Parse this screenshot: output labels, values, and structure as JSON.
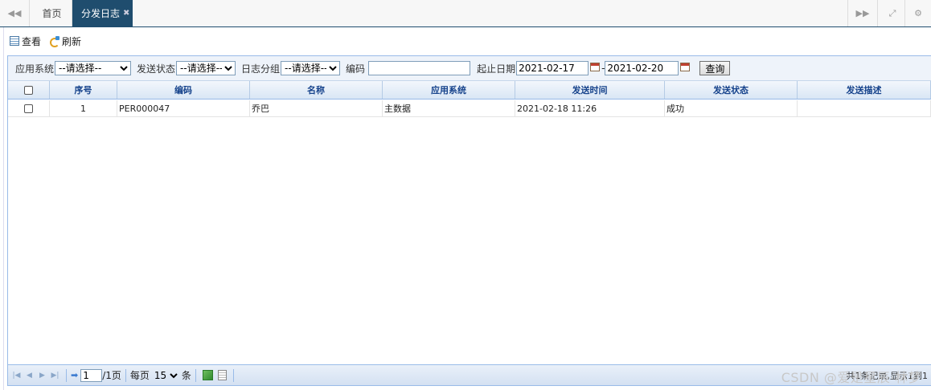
{
  "tabs": {
    "home": "首页",
    "active": "分发日志",
    "close": "✖"
  },
  "nav_icons": [
    "double-chevron-left-icon",
    "double-chevron-right-icon",
    "fullscreen-icon",
    "gear-icon"
  ],
  "toolbar": {
    "view": "查看",
    "refresh": "刷新"
  },
  "filter": {
    "app_label": "应用系统",
    "app_value": "--请选择--",
    "status_label": "发送状态",
    "status_value": "--请选择--",
    "group_label": "日志分组",
    "group_value": "--请选择--",
    "code_label": "编码",
    "code_value": "",
    "date_label": "起止日期",
    "date_start": "2021-02-17",
    "date_sep": "-",
    "date_end": "2021-02-20",
    "query": "查询"
  },
  "columns": [
    "序号",
    "编码",
    "名称",
    "应用系统",
    "发送时间",
    "发送状态",
    "发送描述"
  ],
  "rows": [
    {
      "no": "1",
      "code": "PER000047",
      "name": "乔巴",
      "app": "主数据",
      "time": "2021-02-18 11:26",
      "status": "成功",
      "desc": ""
    }
  ],
  "pager": {
    "page": "1",
    "total_pages": "/1页",
    "per_page_label": "每页",
    "per_page": "15",
    "unit": "条",
    "info": "共1条记录,显示1到1"
  },
  "watermark": "CSDN @爱是星辰·林梦"
}
